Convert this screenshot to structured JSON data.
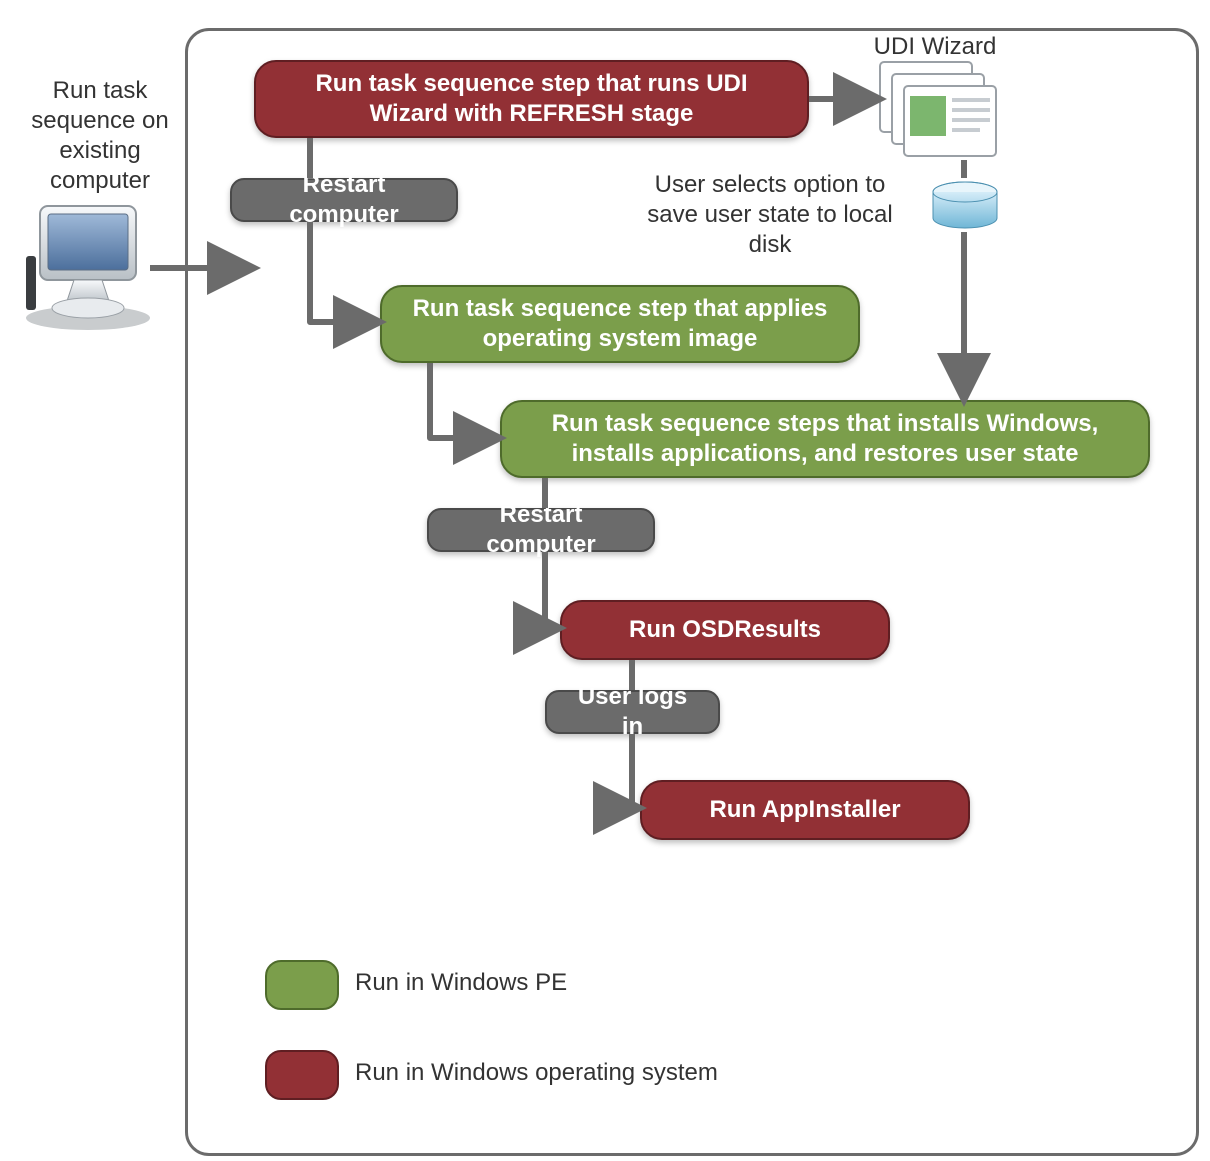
{
  "external": {
    "title": "Run task sequence on existing computer",
    "wizard_title": "UDI Wizard",
    "user_text": "User selects option to save user state to local disk"
  },
  "nodes": {
    "step1": "Run task sequence step  that runs UDI Wizard with REFRESH  stage",
    "restart1": "Restart computer",
    "step2": "Run  task sequence step that applies operating system image",
    "step3": "Run task sequence steps that installs Windows, installs applications, and restores user state",
    "restart2": "Restart computer",
    "step4": "Run OSDResults",
    "userlogs": "User logs in",
    "step5": "Run AppInstaller"
  },
  "legend": {
    "pe": "Run in Windows  PE",
    "os": "Run in Windows operating system"
  },
  "colors": {
    "red": "#923035",
    "green": "#7b9e4b",
    "gray": "#6b6b6b"
  }
}
